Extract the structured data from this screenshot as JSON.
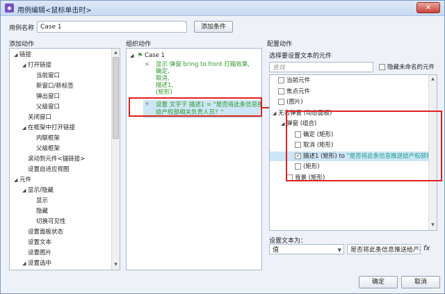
{
  "window": {
    "title": "用例编辑<鼠标单击时>",
    "close_label": "✕"
  },
  "case_name": {
    "label": "用例名称",
    "value": "Case 1",
    "add_condition": "添加条件"
  },
  "add_actions": {
    "header": "添加动作",
    "items": [
      {
        "label": "链接",
        "indent": 0,
        "expander": "◢"
      },
      {
        "label": "打开链接",
        "indent": 1,
        "expander": "◢"
      },
      {
        "label": "当前窗口",
        "indent": 2,
        "expander": ""
      },
      {
        "label": "新窗口/新标签",
        "indent": 2,
        "expander": ""
      },
      {
        "label": "弹出窗口",
        "indent": 2,
        "expander": ""
      },
      {
        "label": "父级窗口",
        "indent": 2,
        "expander": ""
      },
      {
        "label": "关闭窗口",
        "indent": 1,
        "expander": ""
      },
      {
        "label": "在框架中打开链接",
        "indent": 1,
        "expander": "◢"
      },
      {
        "label": "内联框架",
        "indent": 2,
        "expander": ""
      },
      {
        "label": "父级框架",
        "indent": 2,
        "expander": ""
      },
      {
        "label": "滚动到元件<锚链接>",
        "indent": 1,
        "expander": ""
      },
      {
        "label": "设置自适应视图",
        "indent": 1,
        "expander": ""
      },
      {
        "label": "元件",
        "indent": 0,
        "expander": "◢"
      },
      {
        "label": "显示/隐藏",
        "indent": 1,
        "expander": "◢"
      },
      {
        "label": "显示",
        "indent": 2,
        "expander": ""
      },
      {
        "label": "隐藏",
        "indent": 2,
        "expander": ""
      },
      {
        "label": "切换可见性",
        "indent": 2,
        "expander": ""
      },
      {
        "label": "设置面板状态",
        "indent": 1,
        "expander": ""
      },
      {
        "label": "设置文本",
        "indent": 1,
        "expander": ""
      },
      {
        "label": "设置图片",
        "indent": 1,
        "expander": ""
      },
      {
        "label": "设置选中",
        "indent": 1,
        "expander": "◢"
      }
    ]
  },
  "organize": {
    "header": "组织动作",
    "case_label": "Case 1",
    "action1": {
      "lines": [
        "显示 弹窗 bring to front 灯箱效果,",
        "确定,",
        "取消,",
        "描述1,",
        "(矩形)"
      ]
    },
    "action2": {
      "lines": [
        "设置 文字于 描述1 = \"是否将此条信息推送",
        "给产权部相关负责人员？\""
      ]
    }
  },
  "config": {
    "header": "配置动作",
    "select_label": "选择要设置文本的元件",
    "search_placeholder": "查找",
    "hide_unnamed": "隐藏未命名的元件",
    "tree": [
      {
        "label": "当前元件",
        "indent": 0,
        "checked": false,
        "expander": ""
      },
      {
        "label": "焦点元件",
        "indent": 0,
        "checked": false,
        "expander": ""
      },
      {
        "label": "(图片)",
        "indent": 0,
        "checked": false,
        "expander": ""
      },
      {
        "label": "无名弹窗 (动态面板)",
        "indent": 0,
        "checked": false,
        "expander": "◢",
        "nocb": true
      },
      {
        "label": "弹窗 (组合)",
        "indent": 1,
        "checked": false,
        "expander": "◢",
        "nocb": true
      },
      {
        "label": "确定 (矩形)",
        "indent": 2,
        "checked": false,
        "expander": ""
      },
      {
        "label": "取消 (矩形)",
        "indent": 2,
        "checked": false,
        "expander": ""
      },
      {
        "label": "描述1 (矩形) to",
        "indent": 2,
        "checked": true,
        "expander": "",
        "suffix": " \"是否将此条信息推送给产权部相关负\"",
        "selected": true
      },
      {
        "label": "(矩形)",
        "indent": 2,
        "checked": false,
        "expander": ""
      },
      {
        "label": "背景 (矩形)",
        "indent": 1,
        "checked": false,
        "expander": ""
      }
    ],
    "set_text_label": "设置文本为：",
    "value_type": "值",
    "value_text": "是否将此条信息推送给产权部",
    "fx": "fx"
  },
  "footer": {
    "ok": "确定",
    "cancel": "取消"
  },
  "colors": {
    "annotation": "#e02020"
  }
}
